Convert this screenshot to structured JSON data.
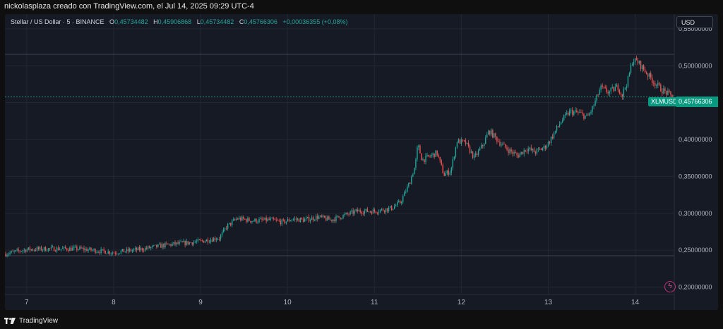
{
  "header": {
    "caption": "nickolasplaza creado con TradingView.com, el Jul 14, 2025 09:29 UTC-4"
  },
  "legend": {
    "symbol": "Stellar / US Dollar · 5 · BINANCE",
    "open_label": "O",
    "open": "0,45734482",
    "high_label": "H",
    "high": "0,45906868",
    "low_label": "L",
    "low": "0,45734482",
    "close_label": "C",
    "close": "0,45766306",
    "change": "+0,00036355 (+0,08%)"
  },
  "toolbar": {
    "currency": "USD"
  },
  "last_price": {
    "ticker": "XLMUSD",
    "value": "0,45766306"
  },
  "footer": {
    "brand": "TradingView"
  },
  "colors": {
    "background": "#161a25",
    "up": "#26a69a",
    "down": "#ef5350",
    "grid": "#242733",
    "accent": "#089981"
  },
  "icons": {
    "logo": "tradingview-logo-icon",
    "lightning": "lightning-icon"
  },
  "chart_data": {
    "type": "candlestick",
    "title": "Stellar / US Dollar · 5 · BINANCE",
    "x_ticks": [
      "7",
      "8",
      "9",
      "10",
      "11",
      "12",
      "13",
      "14"
    ],
    "x_tick_positions_day": [
      7,
      8,
      9,
      10,
      11,
      12,
      13,
      14
    ],
    "y_ticks": [
      "0,55000000",
      "0,50000000",
      "0,45000000",
      "0,40000000",
      "0,35000000",
      "0,30000000",
      "0,25000000",
      "0,20000000"
    ],
    "y_tick_values": [
      0.55,
      0.5,
      0.45,
      0.4,
      0.35,
      0.3,
      0.25,
      0.2
    ],
    "ylim": [
      0.19,
      0.57
    ],
    "xlim_day": [
      6.75,
      14.45
    ],
    "horizontal_lines": [
      0.5155,
      0.4577,
      0.2425
    ],
    "grid": true,
    "price_path": [
      [
        6.75,
        0.245
      ],
      [
        7.0,
        0.251
      ],
      [
        7.3,
        0.252
      ],
      [
        7.6,
        0.252
      ],
      [
        8.0,
        0.247
      ],
      [
        8.3,
        0.251
      ],
      [
        8.6,
        0.257
      ],
      [
        9.0,
        0.262
      ],
      [
        9.22,
        0.267
      ],
      [
        9.3,
        0.282
      ],
      [
        9.42,
        0.293
      ],
      [
        9.6,
        0.29
      ],
      [
        9.8,
        0.291
      ],
      [
        9.95,
        0.288
      ],
      [
        10.05,
        0.292
      ],
      [
        10.2,
        0.291
      ],
      [
        10.35,
        0.295
      ],
      [
        10.5,
        0.291
      ],
      [
        10.65,
        0.297
      ],
      [
        10.8,
        0.303
      ],
      [
        11.0,
        0.303
      ],
      [
        11.2,
        0.307
      ],
      [
        11.3,
        0.315
      ],
      [
        11.4,
        0.34
      ],
      [
        11.47,
        0.365
      ],
      [
        11.5,
        0.393
      ],
      [
        11.55,
        0.372
      ],
      [
        11.65,
        0.378
      ],
      [
        11.72,
        0.382
      ],
      [
        11.8,
        0.352
      ],
      [
        11.88,
        0.358
      ],
      [
        11.95,
        0.398
      ],
      [
        12.05,
        0.395
      ],
      [
        12.15,
        0.375
      ],
      [
        12.25,
        0.393
      ],
      [
        12.32,
        0.412
      ],
      [
        12.45,
        0.395
      ],
      [
        12.55,
        0.385
      ],
      [
        12.65,
        0.378
      ],
      [
        12.75,
        0.388
      ],
      [
        12.85,
        0.383
      ],
      [
        12.95,
        0.389
      ],
      [
        13.0,
        0.395
      ],
      [
        13.15,
        0.425
      ],
      [
        13.25,
        0.438
      ],
      [
        13.35,
        0.436
      ],
      [
        13.45,
        0.43
      ],
      [
        13.52,
        0.445
      ],
      [
        13.6,
        0.47
      ],
      [
        13.7,
        0.464
      ],
      [
        13.8,
        0.472
      ],
      [
        13.85,
        0.46
      ],
      [
        13.92,
        0.482
      ],
      [
        13.97,
        0.508
      ],
      [
        14.03,
        0.505
      ],
      [
        14.1,
        0.495
      ],
      [
        14.2,
        0.48
      ],
      [
        14.3,
        0.468
      ],
      [
        14.4,
        0.46
      ],
      [
        14.45,
        0.4577
      ]
    ],
    "last_close": 0.45766306
  }
}
